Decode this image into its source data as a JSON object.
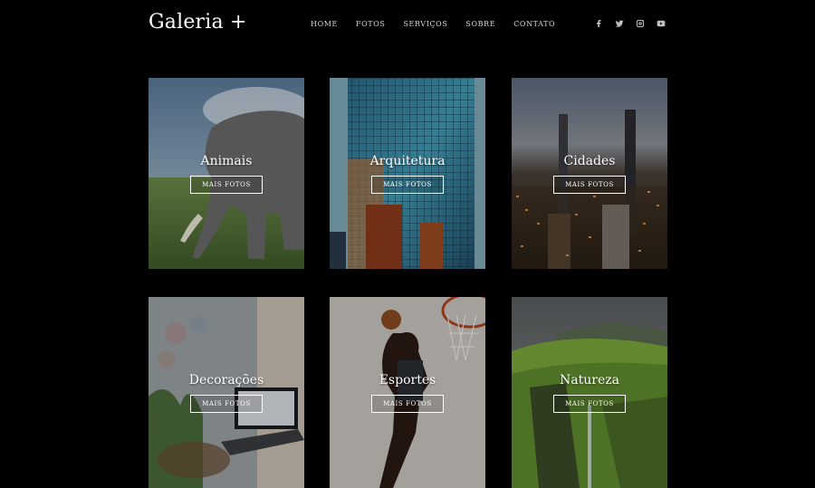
{
  "header": {
    "logo": "Galeria +",
    "nav": [
      "HOME",
      "FOTOS",
      "SERVIÇOS",
      "SOBRE",
      "CONTATO"
    ],
    "social_icons": [
      "facebook-icon",
      "twitter-icon",
      "instagram-icon",
      "youtube-icon"
    ]
  },
  "cards": [
    {
      "title": "Animais",
      "button": "MAIS FOTOS",
      "image": "elephant-photo"
    },
    {
      "title": "Arquitetura",
      "button": "MAIS FOTOS",
      "image": "skyscraper-photo"
    },
    {
      "title": "Cidades",
      "button": "MAIS FOTOS",
      "image": "city-night-photo"
    },
    {
      "title": "Decorações",
      "button": "MAIS FOTOS",
      "image": "laptop-desk-photo"
    },
    {
      "title": "Esportes",
      "button": "MAIS FOTOS",
      "image": "basketball-photo"
    },
    {
      "title": "Natureza",
      "button": "MAIS FOTOS",
      "image": "green-mountain-photo"
    }
  ]
}
